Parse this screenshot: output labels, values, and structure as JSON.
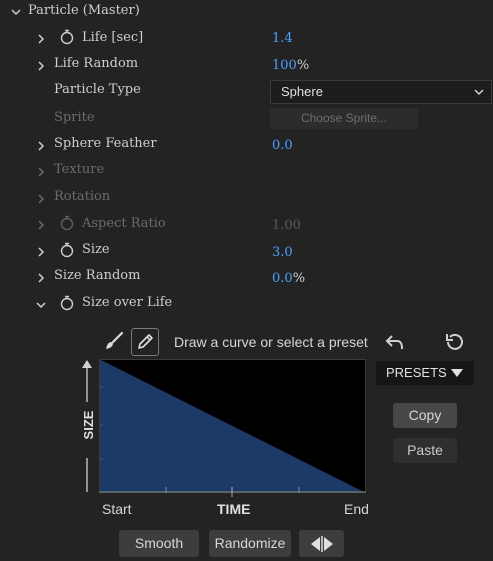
{
  "header": {
    "title": "Particle (Master)"
  },
  "rows": {
    "life": {
      "label": "Life [sec]",
      "value": "1.4",
      "unit": ""
    },
    "life_random": {
      "label": "Life Random",
      "value": "100",
      "unit": "%"
    },
    "particle_type": {
      "label": "Particle Type",
      "selected": "Sphere"
    },
    "sprite": {
      "label": "Sprite",
      "button": "Choose Sprite..."
    },
    "sphere_feather": {
      "label": "Sphere Feather",
      "value": "0.0"
    },
    "texture": {
      "label": "Texture"
    },
    "rotation": {
      "label": "Rotation"
    },
    "aspect_ratio": {
      "label": "Aspect Ratio",
      "value": "1.00"
    },
    "size": {
      "label": "Size",
      "value": "3.0"
    },
    "size_random": {
      "label": "Size Random",
      "value": "0.0",
      "unit": "%"
    },
    "size_over_life": {
      "label": "Size over Life"
    }
  },
  "curve_editor": {
    "hint": "Draw a curve or select a preset",
    "presets_label": "PRESETS",
    "copy_label": "Copy",
    "paste_label": "Paste",
    "y_axis_label": "SIZE",
    "x_axis_label": "TIME",
    "x_start": "Start",
    "x_end": "End",
    "smooth_label": "Smooth",
    "randomize_label": "Randomize",
    "curve_color": "#1b3a66"
  }
}
